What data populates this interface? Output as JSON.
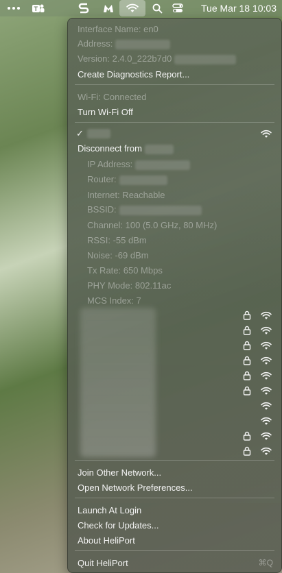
{
  "menubar": {
    "icons": [
      "ellipsis-icon",
      "teams-icon",
      "s-app-icon",
      "malwarebytes-icon",
      "wifi-icon",
      "search-icon",
      "control-center-icon"
    ],
    "datetime": "Tue Mar 18  10:03"
  },
  "menu": {
    "interface_name": "Interface Name: en0",
    "address_label": "Address:",
    "version_label": "Version: 2.4.0_222b7d0",
    "create_diagnostics": "Create Diagnostics Report...",
    "wifi_status": "Wi-Fi: Connected",
    "turn_wifi_off": "Turn Wi-Fi Off",
    "checkmark": "✓",
    "disconnect_label": "Disconnect from",
    "details": {
      "ip": "IP Address:",
      "router": "Router:",
      "internet": "Internet: Reachable",
      "bssid": "BSSID:",
      "channel": "Channel: 100 (5.0 GHz, 80 MHz)",
      "rssi": "RSSI: -55 dBm",
      "noise": "Noise: -69 dBm",
      "tx_rate": "Tx Rate: 650 Mbps",
      "phy_mode": "PHY Mode: 802.11ac",
      "mcs_index": "MCS Index: 7"
    },
    "networks": [
      {
        "locked": true
      },
      {
        "locked": true
      },
      {
        "locked": true
      },
      {
        "locked": true
      },
      {
        "locked": true
      },
      {
        "locked": true
      },
      {
        "locked": false
      },
      {
        "locked": false
      },
      {
        "locked": true
      },
      {
        "locked": true
      }
    ],
    "join_other": "Join Other Network...",
    "open_prefs": "Open Network Preferences...",
    "launch_at_login": "Launch At Login",
    "check_updates": "Check for Updates...",
    "about": "About HeliPort",
    "quit": "Quit HeliPort",
    "quit_shortcut": "⌘Q"
  }
}
